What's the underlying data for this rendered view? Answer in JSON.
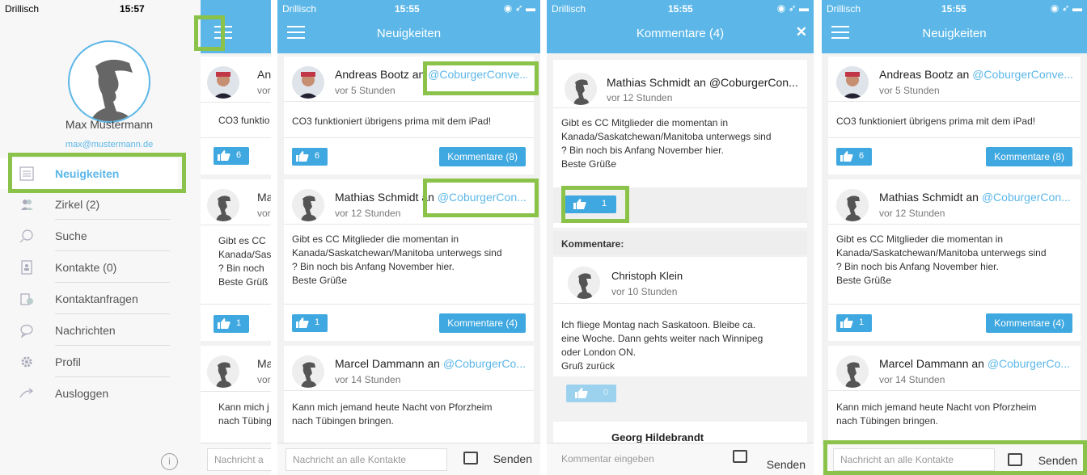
{
  "status": {
    "carrier": "Drillisch",
    "time_menu": "15:57",
    "time": "15:55"
  },
  "colors": {
    "accent": "#5cb7e8",
    "button": "#3fa8e0",
    "highlight": "#8bc34a"
  },
  "menu": {
    "name": "Max Mustermann",
    "email": "max@mustermann.de",
    "items": [
      {
        "label": "Neuigkeiten",
        "icon": "news-icon"
      },
      {
        "label": "Zirkel (2)",
        "icon": "group-icon"
      },
      {
        "label": "Suche",
        "icon": "search-icon"
      },
      {
        "label": "Kontakte (0)",
        "icon": "contacts-icon"
      },
      {
        "label": "Kontaktanfragen",
        "icon": "contact-requests-icon"
      },
      {
        "label": "Nachrichten",
        "icon": "chat-icon"
      },
      {
        "label": "Profil",
        "icon": "gear-icon"
      },
      {
        "label": "Ausloggen",
        "icon": "logout-icon"
      }
    ],
    "peek_author_1": "An",
    "peek_time_1": "vor",
    "peek_body_1": "CO3 funktio",
    "peek_like_1": "6",
    "peek_author_2": "Ma",
    "peek_time_2": "vor",
    "peek_body_2": [
      "Gibt es CC",
      "Kanada/Sas",
      "? Bin noch",
      "Beste Grüß"
    ],
    "peek_like_2": "1",
    "peek_author_3": "Ma",
    "peek_time_3": "vor",
    "peek_body_3": [
      "Kann mich j",
      "nach Tübing"
    ],
    "peek_input": "Nachricht a",
    "info_icon": "i"
  },
  "feed": {
    "title": "Neuigkeiten",
    "posts": [
      {
        "author": "Andreas Bootz an",
        "to": "@CoburgerConve...",
        "time": "vor 5 Stunden",
        "body": [
          "CO3 funktioniert übrigens prima mit dem iPad!"
        ],
        "likes": "6",
        "comments": "Kommentare (8)"
      },
      {
        "author": "Mathias Schmidt an",
        "to": "@CoburgerCon...",
        "time": "vor 12 Stunden",
        "body": [
          "Gibt es CC Mitglieder die momentan in",
          "Kanada/Saskatchewan/Manitoba unterwegs sind",
          "? Bin noch bis Anfang November hier.",
          "Beste Grüße"
        ],
        "likes": "1",
        "comments": "Kommentare (4)"
      },
      {
        "author": "Marcel Dammann an",
        "to": "@CoburgerCo...",
        "time": "vor 14 Stunden",
        "body": [
          "Kann mich jemand heute Nacht von Pforzheim",
          "nach Tübingen bringen."
        ]
      }
    ],
    "input_placeholder": "Nachricht an alle Kontakte",
    "send": "Senden"
  },
  "comments": {
    "title": "Kommentare (4)",
    "close": "✕",
    "post": {
      "author": "Mathias Schmidt an @CoburgerCon...",
      "time": "vor 12 Stunden",
      "body": [
        "Gibt es CC Mitglieder die momentan in",
        "Kanada/Saskatchewan/Manitoba unterwegs sind",
        "? Bin noch bis Anfang November hier.",
        "Beste Grüße"
      ],
      "likes": "1"
    },
    "section_label": "Kommentare:",
    "items": [
      {
        "author": "Christoph Klein",
        "time": "vor 10 Stunden",
        "body": [
          "Ich fliege Montag nach Saskatoon. Bleibe ca.",
          "eine Woche. Dann gehts weiter nach Winnipeg",
          "oder London ON.",
          "Gruß zurück"
        ],
        "likes": "0"
      },
      {
        "author": "Georg Hildebrandt"
      }
    ],
    "input_placeholder": "Kommentar eingeben",
    "send": "Senden"
  }
}
